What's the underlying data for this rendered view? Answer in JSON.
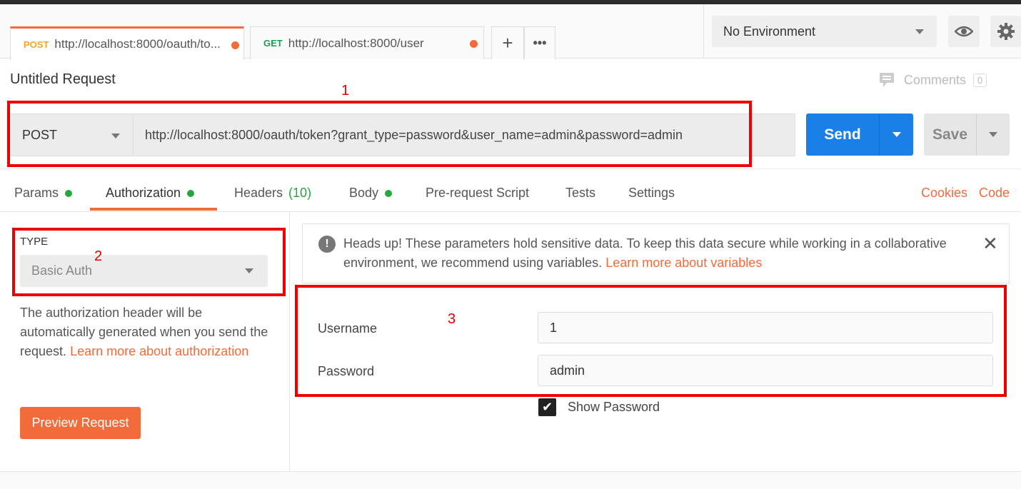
{
  "tabs": [
    {
      "method": "POST",
      "url": "http://localhost:8000/oauth/to..."
    },
    {
      "method": "GET",
      "url": "http://localhost:8000/user"
    }
  ],
  "environment": {
    "selected": "No Environment"
  },
  "request": {
    "title": "Untitled Request",
    "comments_label": "Comments",
    "comments_count": "0",
    "method": "POST",
    "url": "http://localhost:8000/oauth/token?grant_type=password&user_name=admin&password=admin",
    "send_label": "Send",
    "save_label": "Save"
  },
  "subtabs": {
    "params": "Params",
    "authorization": "Authorization",
    "headers": "Headers",
    "headers_count": "(10)",
    "body": "Body",
    "prerequest": "Pre-request Script",
    "tests": "Tests",
    "settings": "Settings",
    "cookies": "Cookies",
    "code": "Code"
  },
  "auth": {
    "type_label": "TYPE",
    "type_value": "Basic Auth",
    "description": "The authorization header will be automatically generated when you send the request.",
    "learn_more": "Learn more about authorization",
    "preview_button": "Preview Request",
    "alert_text": "Heads up! These parameters hold sensitive data. To keep this data secure while working in a collaborative environment, we recommend using variables.",
    "alert_link": "Learn more about variables",
    "username_label": "Username",
    "username_value": "1",
    "password_label": "Password",
    "password_value": "admin",
    "show_password_label": "Show Password",
    "show_password_checked": true
  },
  "annotations": {
    "one": "1",
    "two": "2",
    "three": "3"
  }
}
